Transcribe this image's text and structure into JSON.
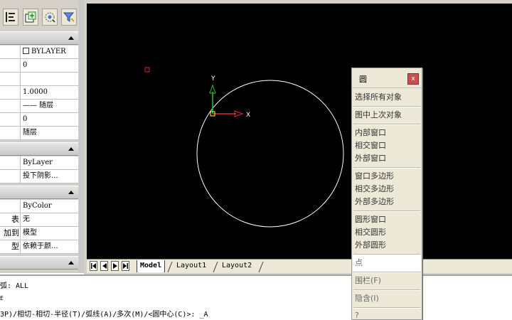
{
  "toolbar": {
    "buttons": [
      "text-align-icon",
      "block-insert-icon",
      "quick-select-icon",
      "filter-icon"
    ]
  },
  "properties": {
    "general_rows": [
      {
        "key": "",
        "value": "BYLAYER",
        "has_checkbox": true
      },
      {
        "key": "",
        "value": "0"
      },
      {
        "key": "",
        "value": ""
      },
      {
        "key": "",
        "value": "1.0000"
      },
      {
        "key": "",
        "value": "—— 随层"
      },
      {
        "key": "",
        "value": "0"
      },
      {
        "key": "",
        "value": "随层"
      }
    ],
    "rendering_rows": [
      {
        "key": "",
        "value": "ByLayer"
      },
      {
        "key": "",
        "value": "投下阴影..."
      }
    ],
    "plot_rows": [
      {
        "key": "",
        "value": "ByColor"
      },
      {
        "key": "表",
        "value": "无"
      },
      {
        "key": "加到",
        "value": "模型"
      },
      {
        "key": "型",
        "value": "依赖于颜..."
      }
    ]
  },
  "drawing": {
    "ucs_x_label": "X",
    "ucs_y_label": "Y",
    "colors": {
      "background": "#000000",
      "circle": "#ffffff",
      "x_axis": "#e03030",
      "y_axis": "#30c030",
      "marker": "#e02020"
    }
  },
  "tabs": {
    "items": [
      {
        "label": "Model",
        "active": true
      },
      {
        "label": "Layout1",
        "active": false
      },
      {
        "label": "Layout2",
        "active": false
      }
    ]
  },
  "command": {
    "line1": "弧: ALL",
    "line2": "E",
    "line3": "3P)/相切-相切-半径(T)/弧线(A)/多次(M)/<圆中心(C)>: _A"
  },
  "context_menu": {
    "title": "圆",
    "close_label": "x",
    "groups": [
      [
        "选择所有对象"
      ],
      [
        "图中上次对象"
      ],
      [
        "内部窗口",
        "相交窗口",
        "外部窗口"
      ],
      [
        "窗口多边形",
        "相交多边形",
        "外部多边形"
      ],
      [
        "圆形窗口",
        "相交圆形",
        "外部圆形"
      ],
      [
        "点"
      ],
      [
        "围栏(F)"
      ],
      [
        "隐含(I)"
      ],
      [
        "?"
      ]
    ]
  }
}
